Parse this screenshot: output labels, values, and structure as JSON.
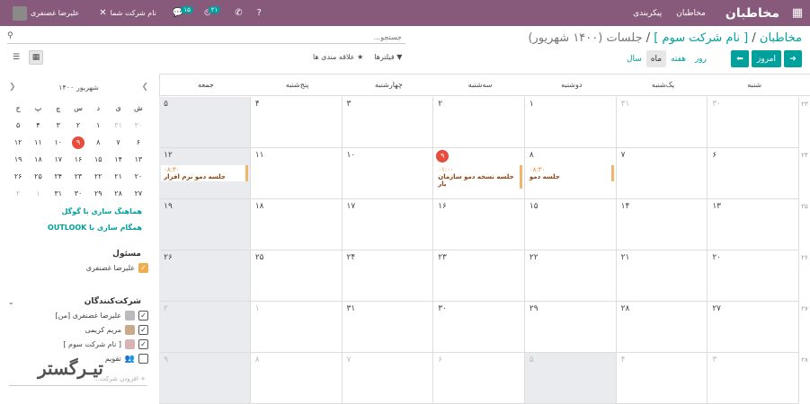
{
  "topbar": {
    "brand": "مخاطبان",
    "menu": [
      "مخاطبان",
      "پیکربندی"
    ],
    "company": "نام شرکت شما",
    "user": "علیرضا غضنفری",
    "badge_chat": "۱۵",
    "badge_activity": "۲۱"
  },
  "search": {
    "placeholder": "جستجو..."
  },
  "breadcrumb": {
    "root": "مخاطبان",
    "contact": "[ نام شرکت سوم ]",
    "current": "جلسات (۱۴۰۰ شهریور)"
  },
  "nav": {
    "today": "امروز"
  },
  "scales": [
    "روز",
    "هفته",
    "ماه",
    "سال"
  ],
  "active_scale": "ماه",
  "filters": {
    "filter_label": "فیلترها",
    "fav_label": "علاقه مندی ها"
  },
  "calendar": {
    "weekdays": [
      "شنبه",
      "یک‌شنبه",
      "دوشنبه",
      "سه‌شنبه",
      "چهارشنبه",
      "پنج‌شنبه",
      "جمعه"
    ],
    "week_numbers": [
      "۲۳",
      "۲۴",
      "۲۵",
      "۲۶",
      "۲۷",
      "۲۸"
    ],
    "weeks": [
      [
        "۳۰",
        "۳۱",
        "۱",
        "۲",
        "۳",
        "۴",
        "۵"
      ],
      [
        "۶",
        "۷",
        "۸",
        "۹",
        "۱۰",
        "۱۱",
        "۱۲"
      ],
      [
        "۱۳",
        "۱۴",
        "۱۵",
        "۱۶",
        "۱۷",
        "۱۸",
        "۱۹"
      ],
      [
        "۲۰",
        "۲۱",
        "۲۲",
        "۲۳",
        "۲۴",
        "۲۵",
        "۲۶"
      ],
      [
        "۲۷",
        "۲۸",
        "۲۹",
        "۳۰",
        "۳۱",
        "۱",
        "۲"
      ],
      [
        "۳",
        "۴",
        "۵",
        "۶",
        "۷",
        "۸",
        "۹"
      ]
    ],
    "events": [
      {
        "time": "۰۸:۳۰",
        "name": "جلسه دمو"
      },
      {
        "time": "۰۱:۰۰",
        "name": "جلسه نسخه دمو سازمان یار"
      },
      {
        "time": "۰۸:۳۰",
        "name": "جلسه دمو نرم افزار"
      }
    ]
  },
  "mini": {
    "title": "شهریور ۱۴۰۰",
    "weekdays": [
      "ش",
      "ی",
      "د",
      "س",
      "چ",
      "پ",
      "ج"
    ],
    "weeks": [
      [
        "۳۰",
        "۳۱",
        "۱",
        "۲",
        "۳",
        "۴",
        "۵"
      ],
      [
        "۶",
        "۷",
        "۸",
        "۹",
        "۱۰",
        "۱۱",
        "۱۲"
      ],
      [
        "۱۳",
        "۱۴",
        "۱۵",
        "۱۶",
        "۱۷",
        "۱۸",
        "۱۹"
      ],
      [
        "۲۰",
        "۲۱",
        "۲۲",
        "۲۳",
        "۲۴",
        "۲۵",
        "۲۶"
      ],
      [
        "۲۷",
        "۲۸",
        "۲۹",
        "۳۰",
        "۳۱",
        "۱",
        "۲"
      ]
    ]
  },
  "sync": {
    "google": "هماهنگ سازی با گوگل",
    "outlook": "همگام سازی با OUTLOOK"
  },
  "responsible": {
    "title": "مسئول",
    "name": "علیرضا غضنفری"
  },
  "attendees": {
    "title": "شرکت‌کنندگان",
    "list": [
      "علیرضا غضنفری [من]",
      "مریم کریمی",
      "[ نام شرکت سوم ]",
      "تقویم"
    ],
    "add_placeholder": "+ افزودن شرکت..."
  },
  "watermark": "تیـرگستر",
  "colors": {
    "topbar": "#875a7b",
    "accent": "#00a09d",
    "today": "#e74c3c",
    "event_border": "#f0b56d"
  }
}
